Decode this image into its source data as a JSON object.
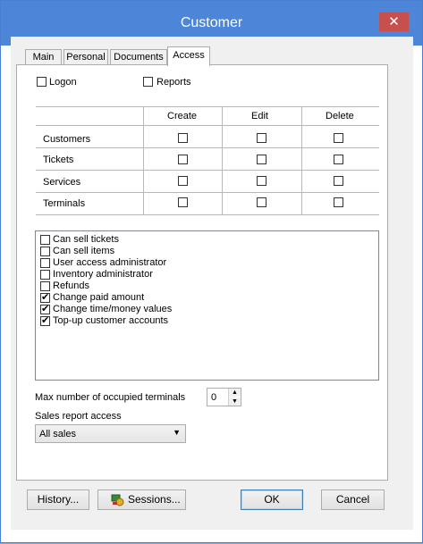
{
  "window": {
    "title": "Customer",
    "close_glyph": "✕"
  },
  "tabs": [
    {
      "label": "Main"
    },
    {
      "label": "Personal"
    },
    {
      "label": "Documents"
    },
    {
      "label": "Access"
    }
  ],
  "top_checks": [
    {
      "label": "Logon",
      "checked": false
    },
    {
      "label": "Reports",
      "checked": false
    }
  ],
  "grid": {
    "columns": [
      "Create",
      "Edit",
      "Delete"
    ],
    "rows": [
      {
        "label": "Customers",
        "create": false,
        "edit": false,
        "delete": false
      },
      {
        "label": "Tickets",
        "create": false,
        "edit": false,
        "delete": false
      },
      {
        "label": "Services",
        "create": false,
        "edit": false,
        "delete": false
      },
      {
        "label": "Terminals",
        "create": false,
        "edit": false,
        "delete": false
      }
    ]
  },
  "permissions": [
    {
      "label": "Can sell tickets",
      "checked": false
    },
    {
      "label": "Can sell items",
      "checked": false
    },
    {
      "label": "User access administrator",
      "checked": false
    },
    {
      "label": "Inventory administrator",
      "checked": false
    },
    {
      "label": "Refunds",
      "checked": false
    },
    {
      "label": "Change paid amount",
      "checked": true
    },
    {
      "label": "Change time/money values",
      "checked": true
    },
    {
      "label": "Top-up customer accounts",
      "checked": true
    }
  ],
  "max_terminals": {
    "label": "Max number of occupied terminals",
    "value": "0"
  },
  "sales_report": {
    "label": "Sales report access",
    "value": "All sales"
  },
  "buttons": {
    "history": "History...",
    "sessions": "Sessions...",
    "ok": "OK",
    "cancel": "Cancel"
  },
  "colors": {
    "titlebar": "#4d86d8",
    "close": "#c7504e",
    "client": "#f0f0f0"
  }
}
